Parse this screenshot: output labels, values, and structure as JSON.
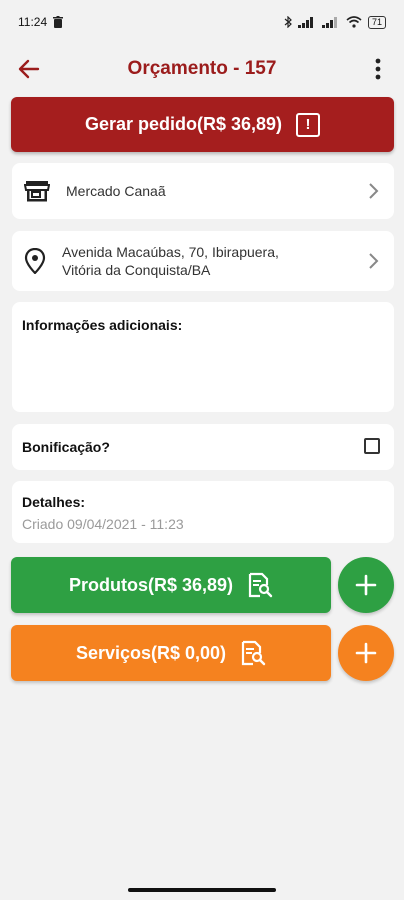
{
  "status_bar": {
    "time": "11:24",
    "battery": "71"
  },
  "app_bar": {
    "title": "Orçamento - 157"
  },
  "gerar_pedido": {
    "label": "Gerar pedido(R$ 36,89)",
    "warning_glyph": "!"
  },
  "store": {
    "name": "Mercado Canaã"
  },
  "address": {
    "line1": "Avenida Macaúbas, 70, Ibirapuera,",
    "line2": "Vitória da Conquista/BA"
  },
  "info": {
    "label": "Informações adicionais:"
  },
  "bonificacao": {
    "label": "Bonificação?",
    "checked": false
  },
  "details": {
    "label": "Detalhes:",
    "created": "Criado 09/04/2021 - 11:23"
  },
  "produtos": {
    "label": "Produtos(R$ 36,89)"
  },
  "servicos": {
    "label": "Serviços(R$ 0,00)"
  },
  "colors": {
    "primary": "#a51e1e",
    "title": "#9b1c1c",
    "green": "#2ea043",
    "orange": "#f5821f",
    "background": "#f2f2f2"
  }
}
